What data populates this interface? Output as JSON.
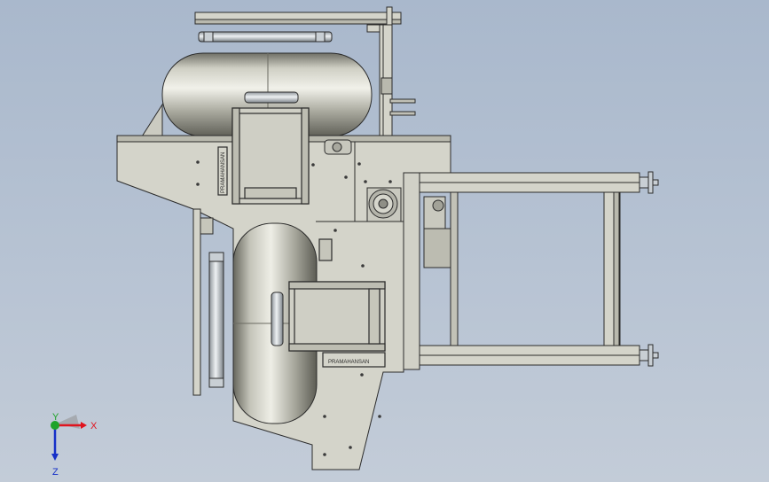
{
  "viewport": {
    "background_top": "#a9b8cc",
    "background_bottom": "#c3ccd8"
  },
  "colors": {
    "plate": "#d4d4ca",
    "plate_dark": "#b9b9ae",
    "edge": "#2b2b2b",
    "drum_light": "#e4e4da",
    "drum_dark": "#77776c",
    "roller": "#c9cfd4",
    "axis_x": "#e0141e",
    "axis_y": "#1fa32a",
    "axis_z": "#1630c8"
  },
  "triad": {
    "x_label": "X",
    "y_label": "Y",
    "z_label": "Z"
  },
  "labels": {
    "plate_tag_upper": "PRAMAHANSAN",
    "plate_tag_lower": "PRAMAHANSAN"
  }
}
